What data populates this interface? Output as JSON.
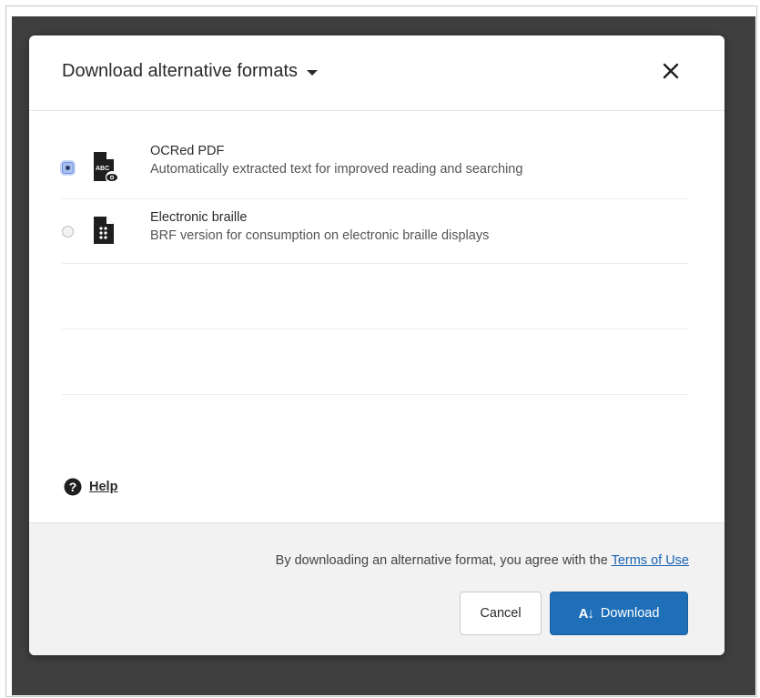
{
  "dialog": {
    "title": "Download alternative formats",
    "close_icon": "close-icon",
    "dropdown_icon": "caret-down-icon"
  },
  "formats": [
    {
      "title": "OCRed PDF",
      "description": "Automatically extracted text for improved reading and searching",
      "icon": "file-abc-eye-icon",
      "icon_text": "ABC",
      "selected": true
    },
    {
      "title": "Electronic braille",
      "description": "BRF version for consumption on electronic braille displays",
      "icon": "file-braille-icon",
      "selected": false
    }
  ],
  "help": {
    "label": "Help",
    "icon": "question-circle-icon"
  },
  "footer": {
    "terms_prefix": "By downloading an alternative format, you agree with the ",
    "terms_link": "Terms of Use",
    "cancel_label": "Cancel",
    "download_label": "Download",
    "download_icon_text": "A",
    "download_icon": "download-arrow-icon"
  },
  "colors": {
    "primary": "#1f6fb8",
    "link": "#1a64b5",
    "backdrop": "#3f3f3f"
  }
}
